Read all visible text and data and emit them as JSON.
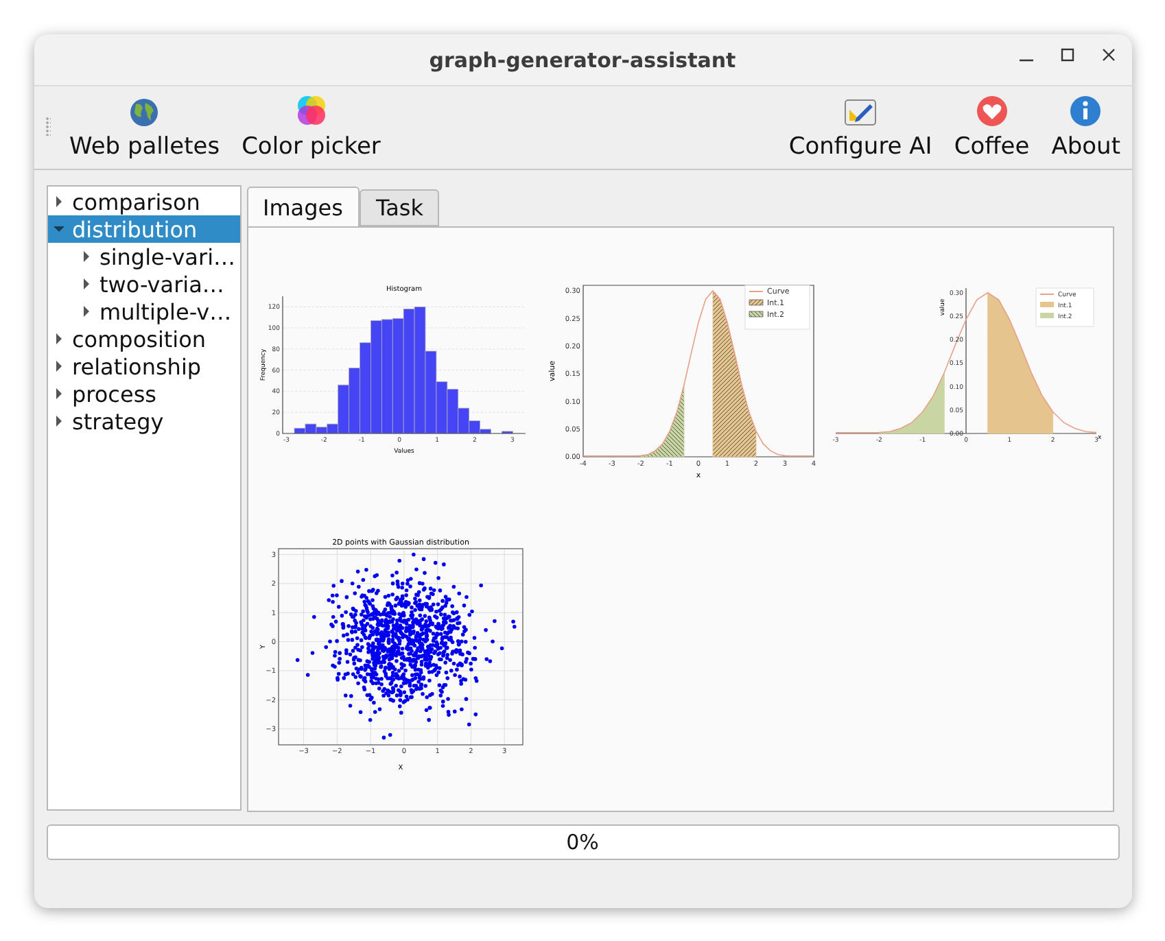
{
  "window": {
    "title": "graph-generator-assistant"
  },
  "toolbar": {
    "left": [
      {
        "label": "Web palletes"
      },
      {
        "label": "Color picker"
      }
    ],
    "right": [
      {
        "label": "Configure AI"
      },
      {
        "label": "Coffee"
      },
      {
        "label": "About"
      }
    ]
  },
  "tree": [
    {
      "label": "comparison",
      "expanded": false,
      "selected": false
    },
    {
      "label": "distribution",
      "expanded": true,
      "selected": true,
      "children": [
        {
          "label": "single-vari…",
          "expanded": false,
          "selected": false
        },
        {
          "label": "two-varia…",
          "expanded": false,
          "selected": false
        },
        {
          "label": "multiple-v…",
          "expanded": false,
          "selected": false
        }
      ]
    },
    {
      "label": "composition",
      "expanded": false,
      "selected": false
    },
    {
      "label": "relationship",
      "expanded": false,
      "selected": false
    },
    {
      "label": "process",
      "expanded": false,
      "selected": false
    },
    {
      "label": "strategy",
      "expanded": false,
      "selected": false
    }
  ],
  "tabs": [
    {
      "label": "Images",
      "selected": true
    },
    {
      "label": "Task",
      "selected": false
    }
  ],
  "images": [
    {
      "chart_data": {
        "type": "bar",
        "title": "Histogram",
        "xlabel": "Values",
        "ylabel": "Frequency",
        "grid": true,
        "x": [
          -2.645,
          -2.355,
          -2.065,
          -1.775,
          -1.485,
          -1.195,
          -0.905,
          -0.615,
          -0.325,
          -0.035,
          0.255,
          0.545,
          0.835,
          1.125,
          1.415,
          1.705,
          1.995,
          2.285,
          2.575,
          2.865
        ],
        "values": [
          5,
          9,
          6,
          9,
          46,
          62,
          86,
          107,
          108,
          109,
          118,
          120,
          78,
          49,
          42,
          24,
          12,
          4,
          0,
          2
        ],
        "xlim": [
          -3.1,
          3.35
        ],
        "ylim": [
          0,
          130
        ],
        "xticks": [
          -3,
          -2,
          -1,
          0,
          1,
          2,
          3
        ],
        "yticks": [
          0,
          20,
          40,
          60,
          80,
          100,
          120
        ]
      }
    },
    {
      "hatched": true,
      "centered_axes": false,
      "chart_data": {
        "type": "line",
        "xlabel": "x",
        "ylabel": "value",
        "legend": true,
        "x": [
          -4,
          -3.75,
          -3.5,
          -3.25,
          -3,
          -2.75,
          -2.5,
          -2.25,
          -2,
          -1.75,
          -1.5,
          -1.25,
          -1,
          -0.75,
          -0.5,
          -0.25,
          0,
          0.25,
          0.5,
          0.75,
          1,
          1.25,
          1.5,
          1.75,
          2,
          2.25,
          2.5,
          2.75,
          3,
          3.25,
          3.5,
          3.75,
          4
        ],
        "series": [
          {
            "name": "Curve",
            "type": "line",
            "color": "#e8a088",
            "values": [
              0,
              0,
              0,
              0,
              0,
              0,
              0,
              0,
              0.002,
              0.004,
              0.011,
              0.023,
              0.046,
              0.081,
              0.13,
              0.188,
              0.243,
              0.285,
              0.3,
              0.285,
              0.243,
              0.188,
              0.13,
              0.081,
              0.046,
              0.023,
              0.011,
              0.004,
              0.002,
              0,
              0,
              0,
              0
            ]
          },
          {
            "name": "Int.1",
            "type": "area",
            "color": "#e6c48e",
            "values": [
              null,
              null,
              null,
              null,
              null,
              null,
              null,
              null,
              null,
              null,
              null,
              null,
              null,
              null,
              null,
              null,
              null,
              null,
              0.3,
              0.285,
              0.243,
              0.188,
              0.13,
              0.081,
              0.046,
              null,
              null,
              null,
              null,
              null,
              null,
              null,
              null
            ]
          },
          {
            "name": "Int.2",
            "type": "area",
            "color": "#c9d6a4",
            "values": [
              null,
              null,
              null,
              null,
              null,
              null,
              null,
              null,
              0.002,
              0.004,
              0.011,
              0.023,
              0.046,
              0.081,
              0.13,
              null,
              null,
              null,
              null,
              null,
              null,
              null,
              null,
              null,
              null,
              null,
              null,
              null,
              null,
              null,
              null,
              null,
              null
            ]
          }
        ],
        "xlim": [
          -4,
          4
        ],
        "ylim": [
          0,
          0.31
        ],
        "xticks": [
          -4,
          -3,
          -2,
          -1,
          0,
          1,
          2,
          3,
          4
        ],
        "yticks": [
          {
            "value": 0,
            "label": "0.00"
          },
          {
            "value": 0.05,
            "label": "0.05"
          },
          {
            "value": 0.1,
            "label": "0.10"
          },
          {
            "value": 0.15,
            "label": "0.15"
          },
          {
            "value": 0.2,
            "label": "0.20"
          },
          {
            "value": 0.25,
            "label": "0.25"
          },
          {
            "value": 0.3,
            "label": "0.30"
          }
        ]
      }
    },
    {
      "hatched": false,
      "centered_axes": true,
      "chart_data": {
        "type": "line",
        "xlabel": "x",
        "ylabel": "value",
        "legend": true,
        "x": [
          -3,
          -2.75,
          -2.5,
          -2.25,
          -2,
          -1.75,
          -1.5,
          -1.25,
          -1,
          -0.75,
          -0.5,
          -0.25,
          0,
          0.25,
          0.5,
          0.75,
          1,
          1.25,
          1.5,
          1.75,
          2,
          2.25,
          2.5,
          2.75,
          3
        ],
        "series": [
          {
            "name": "Curve",
            "type": "line",
            "color": "#e8a088",
            "values": [
              0,
              0,
              0,
              0,
              0.002,
              0.004,
              0.011,
              0.023,
              0.046,
              0.081,
              0.13,
              0.188,
              0.243,
              0.285,
              0.3,
              0.285,
              0.243,
              0.188,
              0.13,
              0.081,
              0.046,
              0.023,
              0.011,
              0.004,
              0.002
            ]
          },
          {
            "name": "Int.1",
            "type": "area",
            "color": "#e6c48e",
            "values": [
              null,
              null,
              null,
              null,
              null,
              null,
              null,
              null,
              null,
              null,
              null,
              null,
              null,
              null,
              0.3,
              0.285,
              0.243,
              0.188,
              0.13,
              0.081,
              0.046,
              null,
              null,
              null,
              null
            ]
          },
          {
            "name": "Int.2",
            "type": "area",
            "color": "#c9d6a4",
            "values": [
              null,
              null,
              null,
              null,
              0.002,
              0.004,
              0.011,
              0.023,
              0.046,
              0.081,
              0.13,
              null,
              null,
              null,
              null,
              null,
              null,
              null,
              null,
              null,
              null,
              null,
              null,
              null,
              null
            ]
          }
        ],
        "xlim": [
          -3,
          3
        ],
        "ylim": [
          0,
          0.31
        ],
        "xticks": [
          -3,
          -2,
          -1,
          0,
          1,
          2,
          3
        ],
        "yticks": [
          {
            "value": 0,
            "label": "0.00"
          },
          {
            "value": 0.05,
            "label": "0.05"
          },
          {
            "value": 0.1,
            "label": "0.10"
          },
          {
            "value": 0.15,
            "label": "0.15"
          },
          {
            "value": 0.2,
            "label": "0.20"
          },
          {
            "value": 0.25,
            "label": "0.25"
          },
          {
            "value": 0.3,
            "label": "0.30"
          }
        ]
      }
    },
    {
      "plot": {
        "title": "2D points with Gaussian distribution",
        "xlabel": "X",
        "ylabel": "Y",
        "xticks": [
          "−3",
          "−2",
          "−1",
          "0",
          "1",
          "2",
          "3"
        ],
        "yticks": [
          "3",
          "2",
          "1",
          "0",
          "−1",
          "−2",
          "−3"
        ]
      }
    }
  ],
  "progress": {
    "level": 0,
    "text": "0%"
  }
}
